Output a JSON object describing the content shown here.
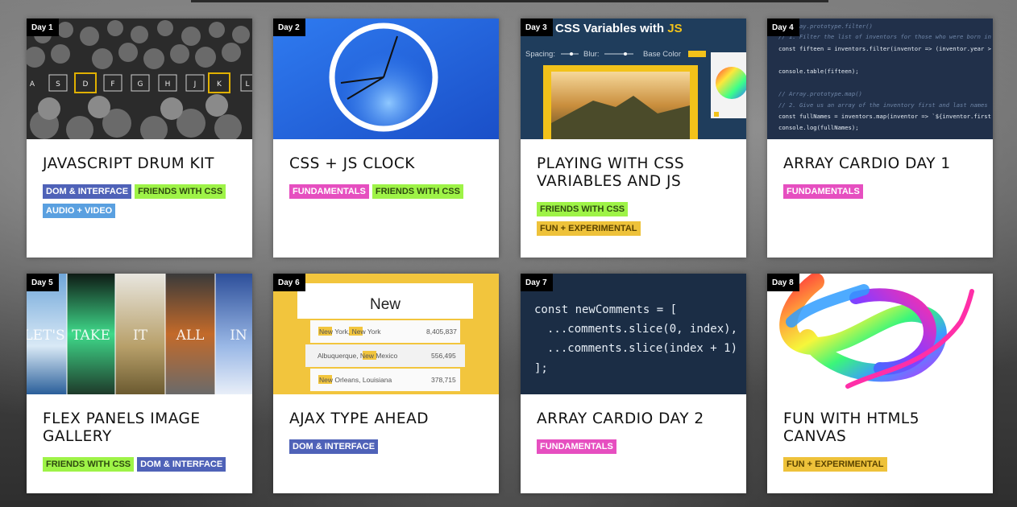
{
  "cards": [
    {
      "day": "Day 1",
      "title": "JavaScript Drum Kit",
      "tags": [
        {
          "label": "DOM & Interface",
          "kind": "dom"
        },
        {
          "label": "Friends with CSS",
          "kind": "css"
        },
        {
          "label": "Audio + Video",
          "kind": "audio"
        }
      ],
      "thumb_text": [
        "A",
        "S",
        "D",
        "F",
        "G",
        "H",
        "J",
        "K",
        "L"
      ]
    },
    {
      "day": "Day 2",
      "title": "CSS + JS Clock",
      "tags": [
        {
          "label": "Fundamentals",
          "kind": "fund"
        },
        {
          "label": "Friends with CSS",
          "kind": "css"
        }
      ]
    },
    {
      "day": "Day 3",
      "title": "Playing with CSS Variables and JS",
      "tags": [
        {
          "label": "Friends with CSS",
          "kind": "css"
        },
        {
          "label": "Fun + Experimental",
          "kind": "fun"
        }
      ],
      "thumb_text": [
        "date CSS Variables with ",
        "JS",
        "Spacing:",
        "Blur:",
        "Base Color"
      ]
    },
    {
      "day": "Day 4",
      "title": "Array Cardio Day 1",
      "tags": [
        {
          "label": "Fundamentals",
          "kind": "fund"
        }
      ],
      "thumb_text": [
        "// Array.prototype.filter()",
        "// 1. Filter the list of inventors for those who were born in",
        "const fifteen = inventors.filter(inventor => (inventor.year >",
        "console.table(fifteen);",
        "// Array.prototype.map()",
        "// 2. Give us an array of the inventory first and last names",
        "const fullNames = inventors.map(inventor => `${inventor.first",
        "console.log(fullNames);"
      ]
    },
    {
      "day": "Day 5",
      "title": "Flex Panels Image Gallery",
      "tags": [
        {
          "label": "Friends with CSS",
          "kind": "css"
        },
        {
          "label": "DOM & Interface",
          "kind": "dom"
        }
      ],
      "thumb_text": [
        "LET'S",
        "TAKE",
        "IT",
        "ALL",
        "IN"
      ]
    },
    {
      "day": "Day 6",
      "title": "Ajax Type Ahead",
      "tags": [
        {
          "label": "DOM & Interface",
          "kind": "dom"
        }
      ],
      "thumb_text": [
        "New",
        "New York, New York",
        "8,405,837",
        "Albuquerque, New Mexico",
        "556,495",
        "New Orleans, Louisiana",
        "378,715"
      ]
    },
    {
      "day": "Day 7",
      "title": "Array Cardio Day 2",
      "tags": [
        {
          "label": "Fundamentals",
          "kind": "fund"
        }
      ],
      "thumb_text": [
        "const newComments = [",
        "...comments.slice(0, index),",
        "...comments.slice(index + 1)",
        "];"
      ]
    },
    {
      "day": "Day 8",
      "title": "Fun with HTML5 Canvas",
      "tags": [
        {
          "label": "Fun + Experimental",
          "kind": "fun"
        }
      ]
    }
  ],
  "colors": {
    "dom": "#4f62b8",
    "css": "#9ef347",
    "audio": "#5aa0e0",
    "fund": "#e64fc0",
    "fun": "#eec23a"
  }
}
